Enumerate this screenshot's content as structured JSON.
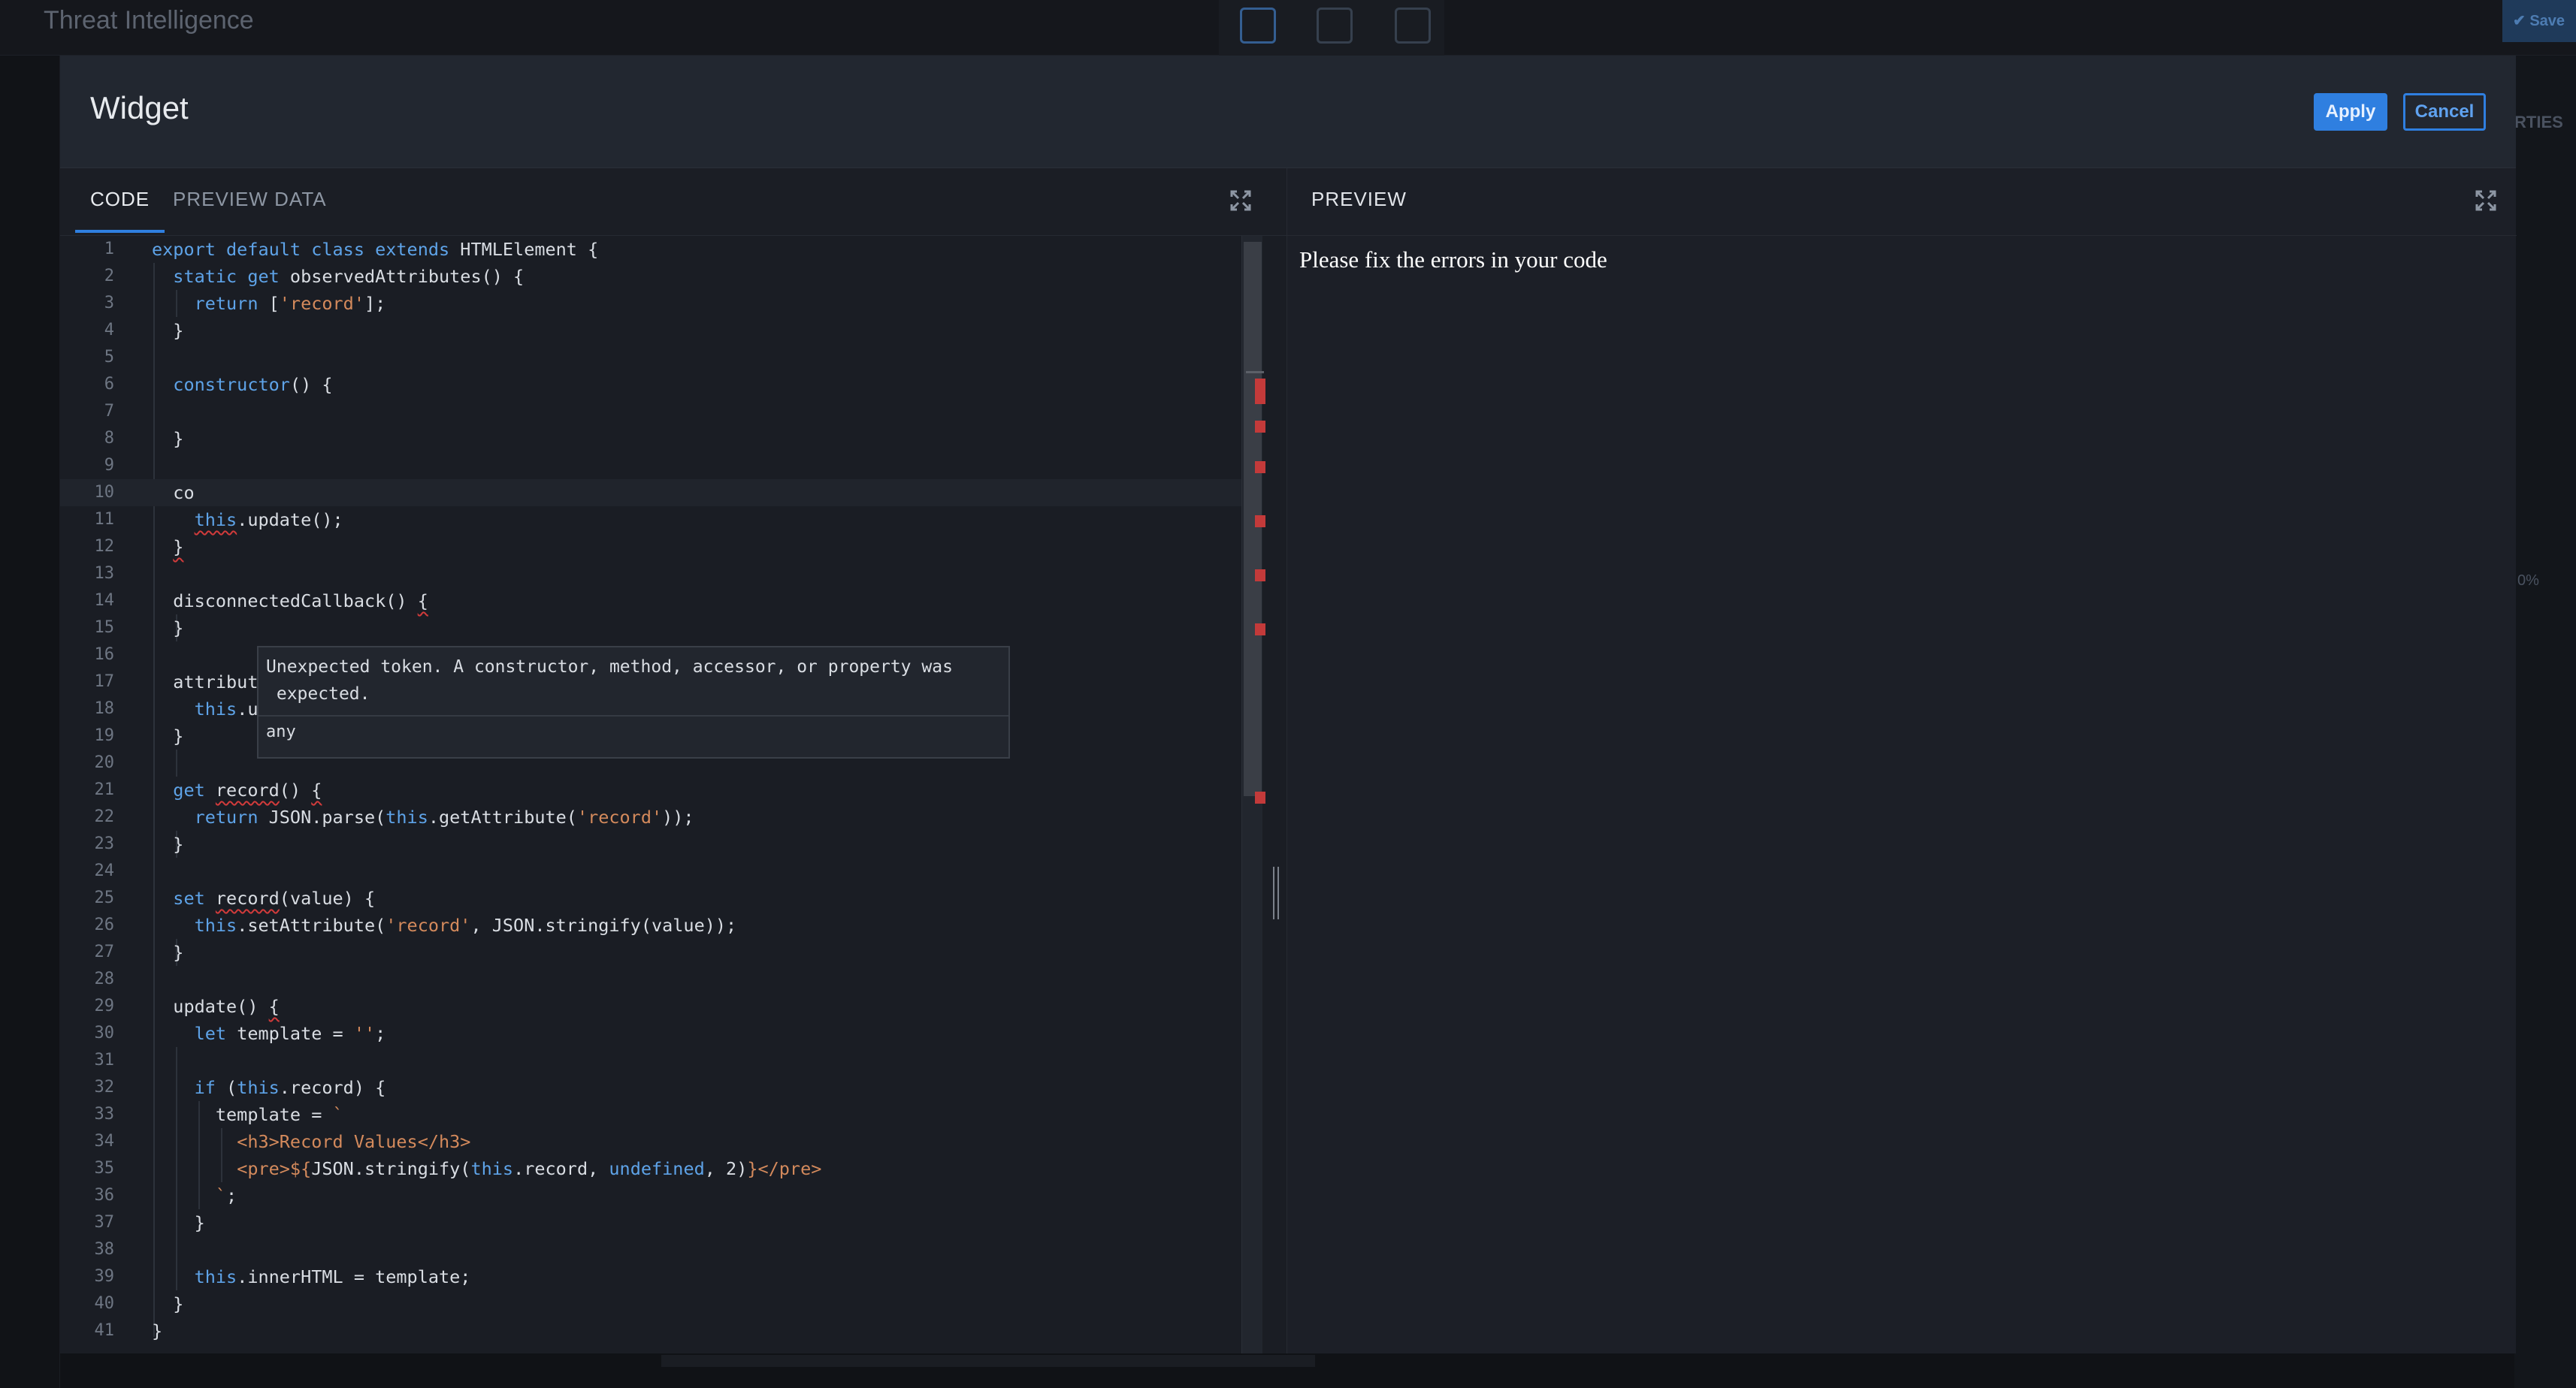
{
  "background": {
    "app_title": "Threat Intelligence",
    "save_label": "✔ Save",
    "right_panel_text": "RTIES",
    "right_panel_pct": "0%"
  },
  "modal": {
    "title": "Widget",
    "apply_label": "Apply",
    "cancel_label": "Cancel"
  },
  "code_pane": {
    "tabs": [
      {
        "label": "CODE",
        "active": true
      },
      {
        "label": "PREVIEW DATA",
        "active": false
      }
    ]
  },
  "editor": {
    "line_numbers": [
      "1",
      "2",
      "3",
      "4",
      "5",
      "6",
      "7",
      "8",
      "9",
      "10",
      "11",
      "12",
      "13",
      "14",
      "15",
      "16",
      "17",
      "18",
      "19",
      "20",
      "21",
      "22",
      "23",
      "24",
      "25",
      "26",
      "27",
      "28",
      "29",
      "30",
      "31",
      "32",
      "33",
      "34",
      "35",
      "36",
      "37",
      "38",
      "39",
      "40",
      "41"
    ],
    "tooltip": {
      "message": "Unexpected token. A constructor, method, accessor, or property was\n expected.",
      "type": "any"
    }
  },
  "preview": {
    "title": "PREVIEW",
    "message": "Please fix the errors in your code"
  }
}
